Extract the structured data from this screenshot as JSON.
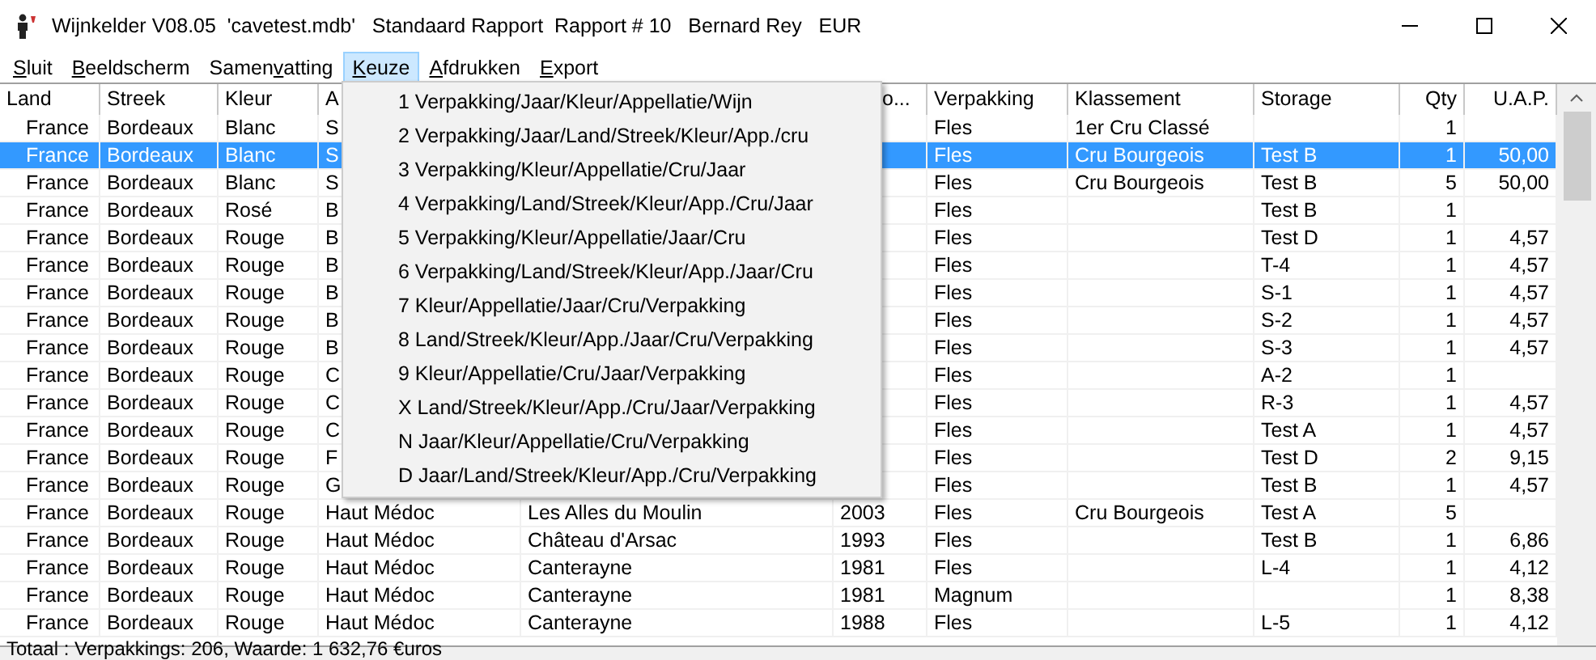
{
  "window": {
    "title": "Wijnkelder V08.05  'cavetest.mdb'   Standaard Rapport  Rapport # 10   Bernard Rey   EUR"
  },
  "menubar": [
    {
      "accel": "S",
      "after": "luit",
      "selected": false
    },
    {
      "accel": "B",
      "after": "eeldscherm",
      "selected": false
    },
    {
      "before": "Samen",
      "accel": "v",
      "after": "atting",
      "selected": false
    },
    {
      "accel": "K",
      "after": "euze",
      "selected": true
    },
    {
      "accel": "A",
      "after": "fdrukken",
      "selected": false
    },
    {
      "accel": "E",
      "after": "xport",
      "selected": false
    }
  ],
  "table": {
    "columns": [
      "Land",
      "Streek",
      "Kleur",
      "A",
      "",
      "o...",
      "Verpakking",
      "Klassement",
      "Storage",
      "Qty",
      "U.A.P."
    ],
    "rows": [
      {
        "selected": false,
        "cells": [
          "France",
          "Bordeaux",
          "Blanc",
          "S",
          "",
          "",
          "Fles",
          "1er Cru Classé",
          "",
          "1",
          ""
        ]
      },
      {
        "selected": true,
        "cells": [
          "France",
          "Bordeaux",
          "Blanc",
          "S",
          "",
          "",
          "Fles",
          "Cru Bourgeois",
          "Test B",
          "1",
          "50,00"
        ]
      },
      {
        "selected": false,
        "cells": [
          "France",
          "Bordeaux",
          "Blanc",
          "S",
          "",
          "",
          "Fles",
          "Cru Bourgeois",
          "Test B",
          "5",
          "50,00"
        ]
      },
      {
        "selected": false,
        "cells": [
          "France",
          "Bordeaux",
          "Rosé",
          "B",
          "",
          "",
          "Fles",
          "",
          "Test B",
          "1",
          ""
        ]
      },
      {
        "selected": false,
        "cells": [
          "France",
          "Bordeaux",
          "Rouge",
          "B",
          "",
          "",
          "Fles",
          "",
          "Test D",
          "1",
          "4,57"
        ]
      },
      {
        "selected": false,
        "cells": [
          "France",
          "Bordeaux",
          "Rouge",
          "B",
          "",
          "",
          "Fles",
          "",
          "T-4",
          "1",
          "4,57"
        ]
      },
      {
        "selected": false,
        "cells": [
          "France",
          "Bordeaux",
          "Rouge",
          "B",
          "",
          "",
          "Fles",
          "",
          "S-1",
          "1",
          "4,57"
        ]
      },
      {
        "selected": false,
        "cells": [
          "France",
          "Bordeaux",
          "Rouge",
          "B",
          "",
          "",
          "Fles",
          "",
          "S-2",
          "1",
          "4,57"
        ]
      },
      {
        "selected": false,
        "cells": [
          "France",
          "Bordeaux",
          "Rouge",
          "B",
          "",
          "",
          "Fles",
          "",
          "S-3",
          "1",
          "4,57"
        ]
      },
      {
        "selected": false,
        "cells": [
          "France",
          "Bordeaux",
          "Rouge",
          "C",
          "",
          "",
          "Fles",
          "",
          "A-2",
          "1",
          ""
        ]
      },
      {
        "selected": false,
        "cells": [
          "France",
          "Bordeaux",
          "Rouge",
          "C",
          "",
          "",
          "Fles",
          "",
          "R-3",
          "1",
          "4,57"
        ]
      },
      {
        "selected": false,
        "cells": [
          "France",
          "Bordeaux",
          "Rouge",
          "C",
          "",
          "",
          "Fles",
          "",
          "Test A",
          "1",
          "4,57"
        ]
      },
      {
        "selected": false,
        "cells": [
          "France",
          "Bordeaux",
          "Rouge",
          "F",
          "",
          "",
          "Fles",
          "",
          "Test D",
          "2",
          "9,15"
        ]
      },
      {
        "selected": false,
        "cells": [
          "France",
          "Bordeaux",
          "Rouge",
          "G",
          "",
          "",
          "Fles",
          "",
          "Test B",
          "1",
          "4,57"
        ]
      },
      {
        "selected": false,
        "cells": [
          "France",
          "Bordeaux",
          "Rouge",
          "Haut Médoc",
          "Les Alles du Moulin",
          "2003",
          "Fles",
          "Cru Bourgeois",
          "Test A",
          "5",
          ""
        ]
      },
      {
        "selected": false,
        "cells": [
          "France",
          "Bordeaux",
          "Rouge",
          "Haut Médoc",
          "Château d'Arsac",
          "1993",
          "Fles",
          "",
          "Test B",
          "1",
          "6,86"
        ]
      },
      {
        "selected": false,
        "cells": [
          "France",
          "Bordeaux",
          "Rouge",
          "Haut Médoc",
          "Canterayne",
          "1981",
          "Fles",
          "",
          "L-4",
          "1",
          "4,12"
        ]
      },
      {
        "selected": false,
        "cells": [
          "France",
          "Bordeaux",
          "Rouge",
          "Haut Médoc",
          "Canterayne",
          "1981",
          "Magnum",
          "",
          "",
          "1",
          "8,38"
        ]
      },
      {
        "selected": false,
        "cells": [
          "France",
          "Bordeaux",
          "Rouge",
          "Haut Médoc",
          "Canterayne",
          "1988",
          "Fles",
          "",
          "L-5",
          "1",
          "4,12"
        ]
      }
    ]
  },
  "dropdown": {
    "items": [
      "1 Verpakking/Jaar/Kleur/Appellatie/Wijn",
      "2 Verpakking/Jaar/Land/Streek/Kleur/App./cru",
      "3 Verpakking/Kleur/Appellatie/Cru/Jaar",
      "4 Verpakking/Land/Streek/Kleur/App./Cru/Jaar",
      "5 Verpakking/Kleur/Appellatie/Jaar/Cru",
      "6 Verpakking/Land/Streek/Kleur/App./Jaar/Cru",
      "7 Kleur/Appellatie/Jaar/Cru/Verpakking",
      "8 Land/Streek/Kleur/App./Jaar/Cru/Verpakking",
      "9 Kleur/Appellatie/Cru/Jaar/Verpakking",
      "X Land/Streek/Kleur/App./Cru/Jaar/Verpakking",
      "N Jaar/Kleur/Appellatie/Cru/Verpakking",
      "D Jaar/Land/Streek/Kleur/App./Cru/Verpakking"
    ]
  },
  "status_bar": "Totaal : Verpakkings: 206, Waarde: 1 632,76 €uros"
}
